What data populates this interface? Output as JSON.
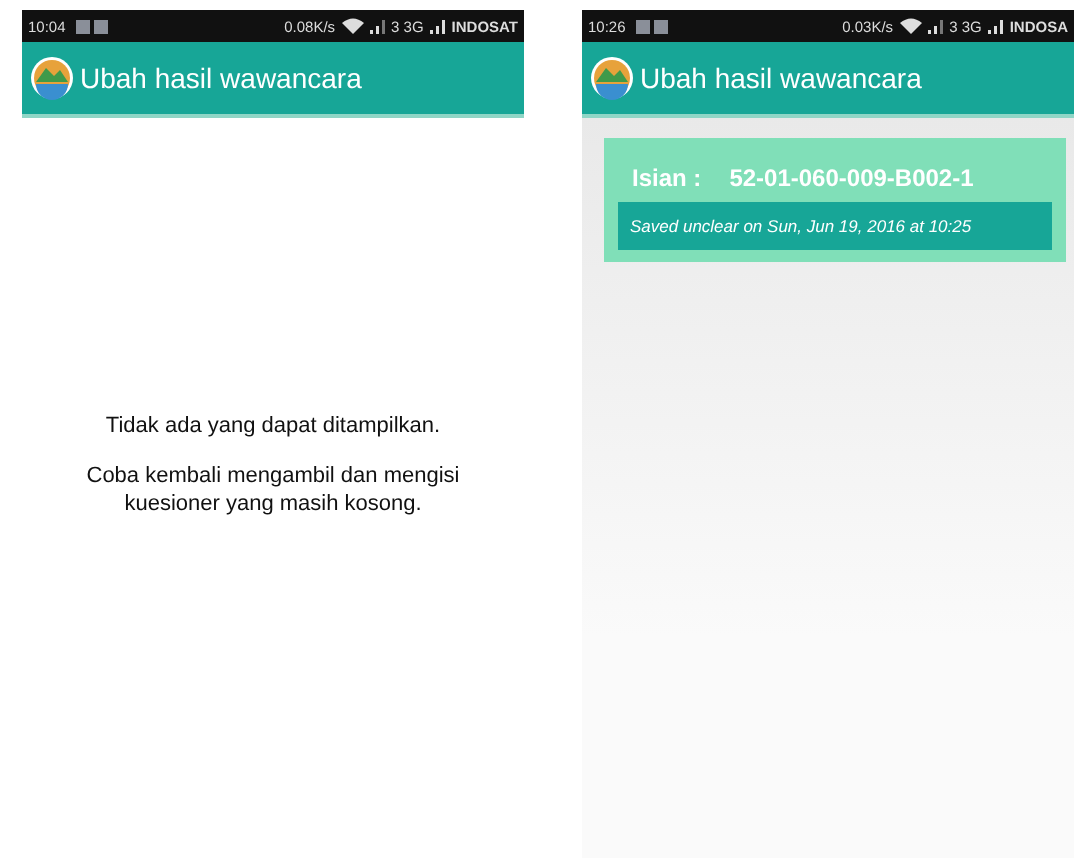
{
  "screens": [
    {
      "status_bar": {
        "time": "10:04",
        "speed": "0.08K/s",
        "network": "3 3G",
        "carrier": "INDOSAT"
      },
      "app_bar": {
        "title": "Ubah hasil wawancara"
      },
      "kind": "empty",
      "empty_message": "Tidak ada yang dapat ditampilkan.",
      "empty_hint": "Coba kembali mengambil dan mengisi kuesioner yang masih kosong."
    },
    {
      "status_bar": {
        "time": "10:26",
        "speed": "0.03K/s",
        "network": "3 3G",
        "carrier": "INDOSA"
      },
      "app_bar": {
        "title": "Ubah hasil wawancara"
      },
      "kind": "list",
      "items": [
        {
          "label": "Isian :",
          "code": "52-01-060-009-B002-1",
          "note": "Saved unclear on Sun, Jun 19, 2016 at 10:25"
        }
      ]
    }
  ]
}
